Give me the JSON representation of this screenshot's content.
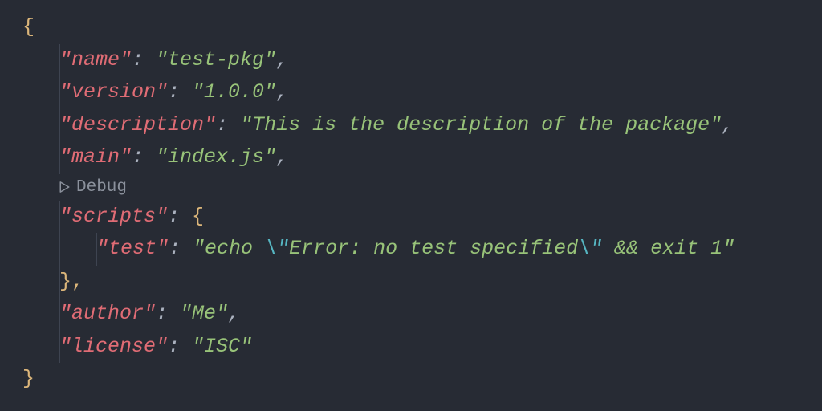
{
  "code": {
    "braceOpen": "{",
    "braceClose": "}",
    "innerBraceOpen": "{",
    "innerBraceClose": "},",
    "colon": ": ",
    "lines": {
      "name": {
        "key": "\"name\"",
        "value": "\"test-pkg\"",
        "suffix": ","
      },
      "version": {
        "key": "\"version\"",
        "value": "\"1.0.0\"",
        "suffix": ","
      },
      "description": {
        "key": "\"description\"",
        "value": "\"This is the description of the package\"",
        "suffix": ","
      },
      "main": {
        "key": "\"main\"",
        "value": "\"index.js\"",
        "suffix": ","
      },
      "scripts": {
        "key": "\"scripts\""
      },
      "test": {
        "key": "\"test\"",
        "valuePrefix": "\"echo ",
        "escapeOpen": "\\\"",
        "valueMid": "Error: no test specified",
        "escapeClose": "\\\"",
        "amp": " && ",
        "valueEnd": "exit 1\""
      },
      "author": {
        "key": "\"author\"",
        "value": "\"Me\"",
        "suffix": ","
      },
      "license": {
        "key": "\"license\"",
        "value": "\"ISC\""
      }
    }
  },
  "codelens": {
    "debug": "Debug"
  }
}
